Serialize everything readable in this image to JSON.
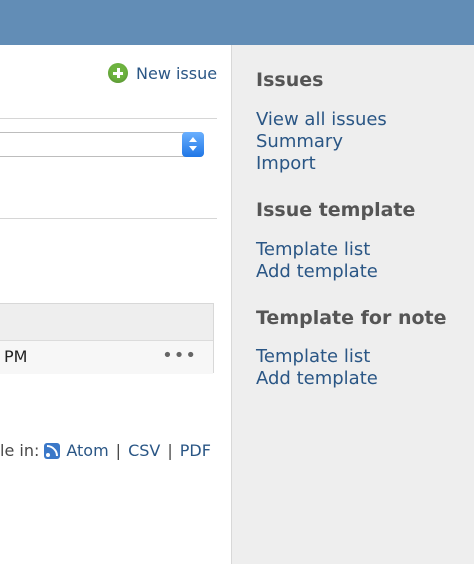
{
  "main": {
    "new_issue_label": "New issue",
    "table": {
      "row_time": "PM",
      "row_menu": "•••"
    },
    "export": {
      "prefix": "le in:",
      "atom": "Atom",
      "csv": "CSV",
      "pdf": "PDF",
      "separator": "|"
    }
  },
  "sidebar": {
    "issues": {
      "heading": "Issues",
      "links": [
        "View all issues",
        "Summary",
        "Import"
      ]
    },
    "issue_template": {
      "heading": "Issue template",
      "links": [
        "Template list",
        "Add template"
      ]
    },
    "template_for_note": {
      "heading": "Template for note",
      "links": [
        "Template list",
        "Add template"
      ]
    }
  },
  "colors": {
    "top_bar": "#628db6",
    "link": "#2a5685",
    "sidebar_bg": "#eeeeee",
    "plus_icon": "#6db33f",
    "rss_icon": "#3b78c8"
  }
}
